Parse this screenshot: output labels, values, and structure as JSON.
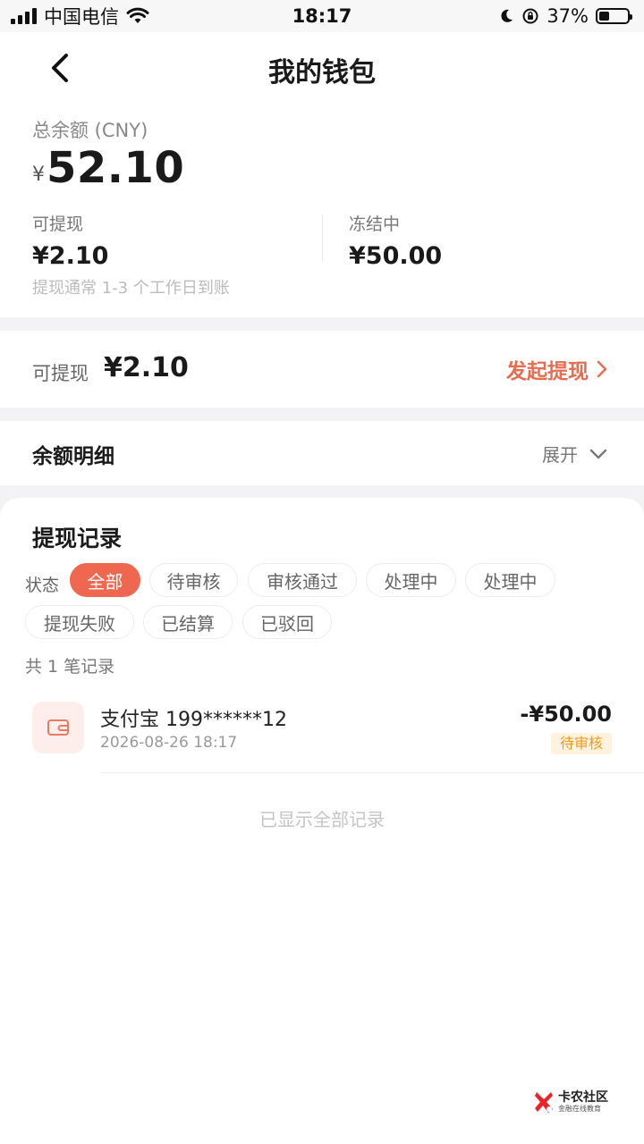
{
  "status_bar": {
    "carrier": "中国电信",
    "time": "18:17",
    "battery_percent": "37%",
    "battery_level": 0.37
  },
  "header": {
    "title": "我的钱包",
    "back_icon": "chevron-left-icon"
  },
  "balance": {
    "total_label": "总余额 (CNY)",
    "currency_symbol": "¥",
    "total_amount": "52.10",
    "available_label": "可提现",
    "available_amount": "¥2.10",
    "frozen_label": "冻结中",
    "frozen_amount": "¥50.00",
    "note": "提现通常 1-3 个工作日到账"
  },
  "withdraw": {
    "label": "可提现",
    "amount": "¥2.10",
    "action_label": "发起提现"
  },
  "detail": {
    "title": "余额明细",
    "toggle_label": "展开"
  },
  "records": {
    "title": "提现记录",
    "filter_label": "状态",
    "filters": [
      {
        "label": "全部",
        "active": true
      },
      {
        "label": "待审核",
        "active": false
      },
      {
        "label": "审核通过",
        "active": false
      },
      {
        "label": "处理中",
        "active": false
      },
      {
        "label": "处理中",
        "active": false
      },
      {
        "label": "提现失败",
        "active": false
      },
      {
        "label": "已结算",
        "active": false
      },
      {
        "label": "已驳回",
        "active": false
      }
    ],
    "count_text": "共 1 笔记录",
    "items": [
      {
        "icon": "wallet-icon",
        "name": "支付宝 199******12",
        "time": "2026-08-26 18:17",
        "amount": "-¥50.00",
        "status": "待审核"
      }
    ],
    "end_text": "已显示全部记录"
  },
  "watermark": {
    "name": "卡农社区",
    "tagline": "金融在线教育"
  },
  "colors": {
    "accent": "#f0674f",
    "action_text": "#e66d4f",
    "pending_badge_bg": "#fff3e0",
    "pending_badge_text": "#f29a1f"
  }
}
